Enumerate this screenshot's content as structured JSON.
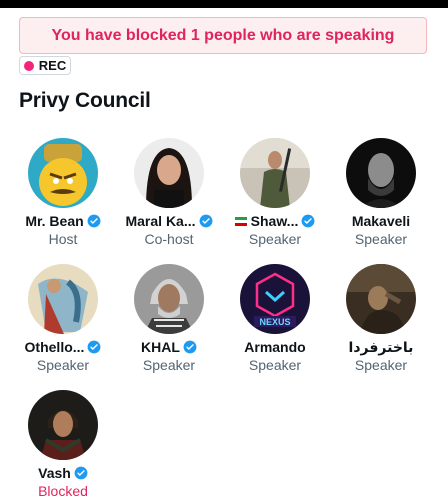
{
  "banner": {
    "text": "You have blocked 1 people who are speaking"
  },
  "recording": {
    "label": "REC"
  },
  "section": {
    "title": "Privy Council"
  },
  "colors": {
    "accent": "#1d9bf0",
    "alert": "#e0245e",
    "rec_dot": "#f4247c"
  },
  "speakers": [
    {
      "name": "Mr. Bean",
      "role": "Host",
      "verified": true
    },
    {
      "name": "Maral Ka...",
      "role": "Co-host",
      "verified": true
    },
    {
      "name": "Shaw...",
      "role": "Speaker",
      "verified": true,
      "flag": "iran-flag-icon"
    },
    {
      "name": "Makaveli",
      "role": "Speaker",
      "verified": false
    },
    {
      "name": "Othello...",
      "role": "Speaker",
      "verified": true
    },
    {
      "name": "KHAL",
      "role": "Speaker",
      "verified": true
    },
    {
      "name": "Armando",
      "role": "Speaker",
      "verified": false
    },
    {
      "name": "باخترفردا",
      "role": "Speaker",
      "verified": false
    },
    {
      "name": "Vash",
      "role": "Blocked",
      "verified": true
    }
  ]
}
